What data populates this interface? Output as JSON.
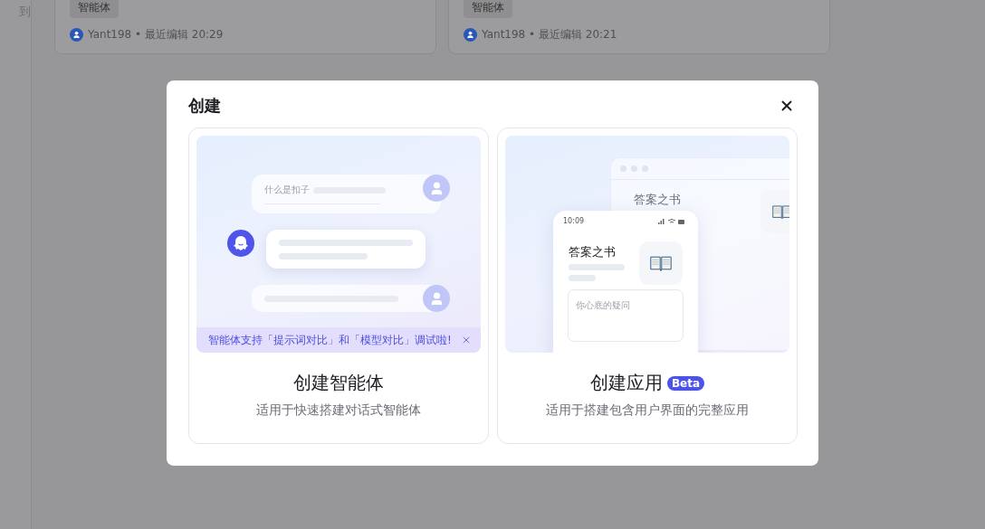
{
  "sidebar": {
    "items": [
      {
        "label": "到"
      }
    ]
  },
  "background_cards": [
    {
      "tag": "智能体",
      "meta": "Yant198 • 最近编辑 20:29"
    },
    {
      "tag": "智能体",
      "meta": "Yant198 • 最近编辑 20:21"
    }
  ],
  "dialog": {
    "title": "创建",
    "options": [
      {
        "kind": "agent",
        "title": "创建智能体",
        "subtitle": "适用于快速搭建对话式智能体",
        "illustration": {
          "question": "什么是扣子",
          "banner": "智能体支持「提示词对比」和「模型对比」调试啦!"
        }
      },
      {
        "kind": "app",
        "title": "创建应用",
        "badge": "Beta",
        "subtitle": "适用于搭建包含用户界面的完整应用",
        "illustration": {
          "window_title": "答案之书",
          "phone_time": "10:09",
          "phone_title": "答案之书",
          "input_placeholder": "你心底的疑问"
        }
      }
    ]
  }
}
